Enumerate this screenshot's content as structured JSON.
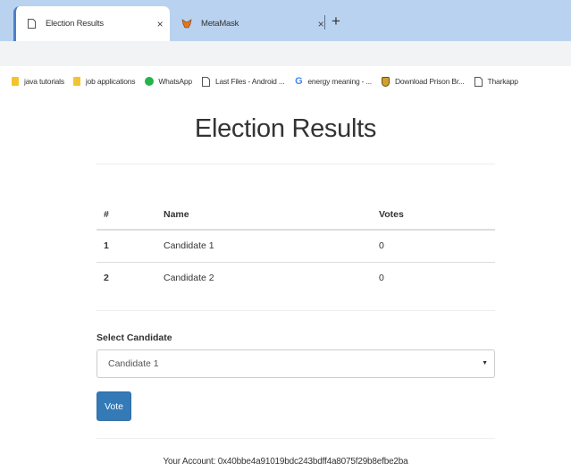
{
  "browser": {
    "tabs": [
      {
        "title": "Election Results",
        "icon": "page-icon",
        "active": true
      },
      {
        "title": "MetaMask",
        "icon": "metamask-fox-icon",
        "active": false
      }
    ],
    "close_glyph": "×",
    "new_tab_glyph": "+",
    "bookmarks": [
      {
        "label": "java tutorials",
        "icon": "folder-icon"
      },
      {
        "label": "job applications",
        "icon": "folder-icon"
      },
      {
        "label": "WhatsApp",
        "icon": "whatsapp-icon"
      },
      {
        "label": "Last Files - Android ...",
        "icon": "page-icon"
      },
      {
        "label": "energy meaning - ...",
        "icon": "google-icon"
      },
      {
        "label": "Download Prison Br...",
        "icon": "shield-icon"
      },
      {
        "label": "Tharkapp",
        "icon": "page-icon"
      }
    ]
  },
  "page": {
    "title": "Election Results",
    "table": {
      "headers": [
        "#",
        "Name",
        "Votes"
      ],
      "rows": [
        {
          "num": "1",
          "name": "Candidate 1",
          "votes": "0"
        },
        {
          "num": "2",
          "name": "Candidate 2",
          "votes": "0"
        }
      ]
    },
    "select_label": "Select Candidate",
    "select_value": "Candidate 1",
    "vote_button": "Vote",
    "account_text": "Your Account: 0x40bbe4a91019bdc243bdff4a8075f29b8efbe2ba"
  },
  "colors": {
    "tabstrip": "#b9d2ef",
    "primary_button": "#337ab7"
  }
}
